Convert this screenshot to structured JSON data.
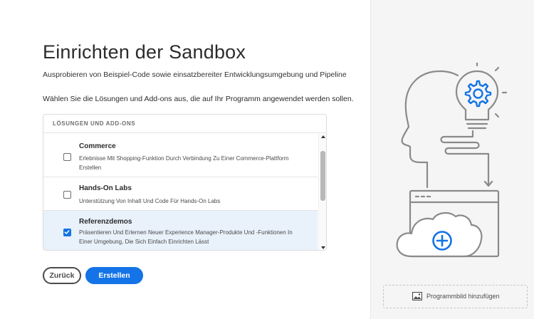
{
  "page": {
    "title": "Einrichten der Sandbox",
    "subtitle": "Ausprobieren von Beispiel-Code sowie einsatzbereiter Entwicklungsumgebung und Pipeline",
    "instruction": "Wählen Sie die Lösungen und Add-ons aus, die auf Ihr Programm angewendet werden sollen."
  },
  "panel": {
    "header": "LÖSUNGEN UND ADD-ONS",
    "items": [
      {
        "title": "Commerce",
        "desc": "Erlebnisse Mit Shopping-Funktion Durch Verbindung Zu Einer Commerce-Plattform Erstellen",
        "checked": false
      },
      {
        "title": "Hands-On Labs",
        "desc": "Unterstützung Von Inhalt Und Code Für Hands-On Labs",
        "checked": false
      },
      {
        "title": "Referenzdemos",
        "desc": "Präsentieren Und Erlernen Neuer Experience Manager-Produkte Und -Funktionen In Einer Umgebung, Die Sich Einfach Einrichten Lässt",
        "checked": true
      }
    ]
  },
  "buttons": {
    "back": "Zurück",
    "create": "Erstellen"
  },
  "sidebar": {
    "add_image": "Programmbild hinzufügen",
    "icons": {
      "illustration": "head-lightbulb-gear-cloud-illustration",
      "add_image": "image-icon"
    }
  },
  "colors": {
    "accent": "#1473e6",
    "selected_row": "#e9f1fb",
    "illustration_stroke": "#8a8a8a"
  }
}
